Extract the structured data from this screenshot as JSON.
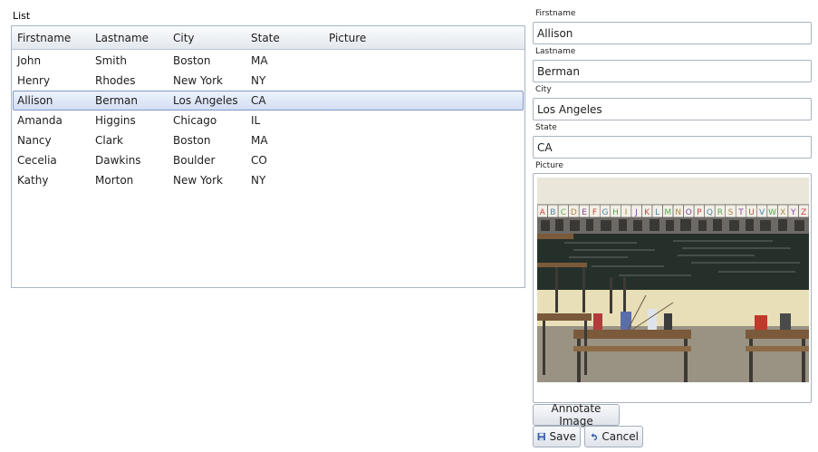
{
  "list": {
    "label": "List",
    "columns": [
      "Firstname",
      "Lastname",
      "City",
      "State",
      "Picture"
    ],
    "rows": [
      {
        "firstname": "John",
        "lastname": "Smith",
        "city": "Boston",
        "state": "MA"
      },
      {
        "firstname": "Henry",
        "lastname": "Rhodes",
        "city": "New York",
        "state": "NY"
      },
      {
        "firstname": "Allison",
        "lastname": "Berman",
        "city": "Los Angeles",
        "state": "CA"
      },
      {
        "firstname": "Amanda",
        "lastname": "Higgins",
        "city": "Chicago",
        "state": "IL"
      },
      {
        "firstname": "Nancy",
        "lastname": "Clark",
        "city": "Boston",
        "state": "MA"
      },
      {
        "firstname": "Cecelia",
        "lastname": "Dawkins",
        "city": "Boulder",
        "state": "CO"
      },
      {
        "firstname": "Kathy",
        "lastname": "Morton",
        "city": "New York",
        "state": "NY"
      }
    ],
    "selected_index": 2
  },
  "details": {
    "firstname_label": "Firstname",
    "firstname_value": "Allison",
    "lastname_label": "Lastname",
    "lastname_value": "Berman",
    "city_label": "City",
    "city_value": "Los Angeles",
    "state_label": "State",
    "state_value": "CA",
    "picture_label": "Picture",
    "picture_alphabet": "ABCDEFGHIJKLMNOPQRSTUVWXYZ"
  },
  "buttons": {
    "annotate_label": "Annotate Image",
    "save_label": "Save",
    "cancel_label": "Cancel"
  },
  "colors": {
    "selection": "#d3def4",
    "border": "#a9b6c6",
    "chalkboard": "#26302b"
  }
}
